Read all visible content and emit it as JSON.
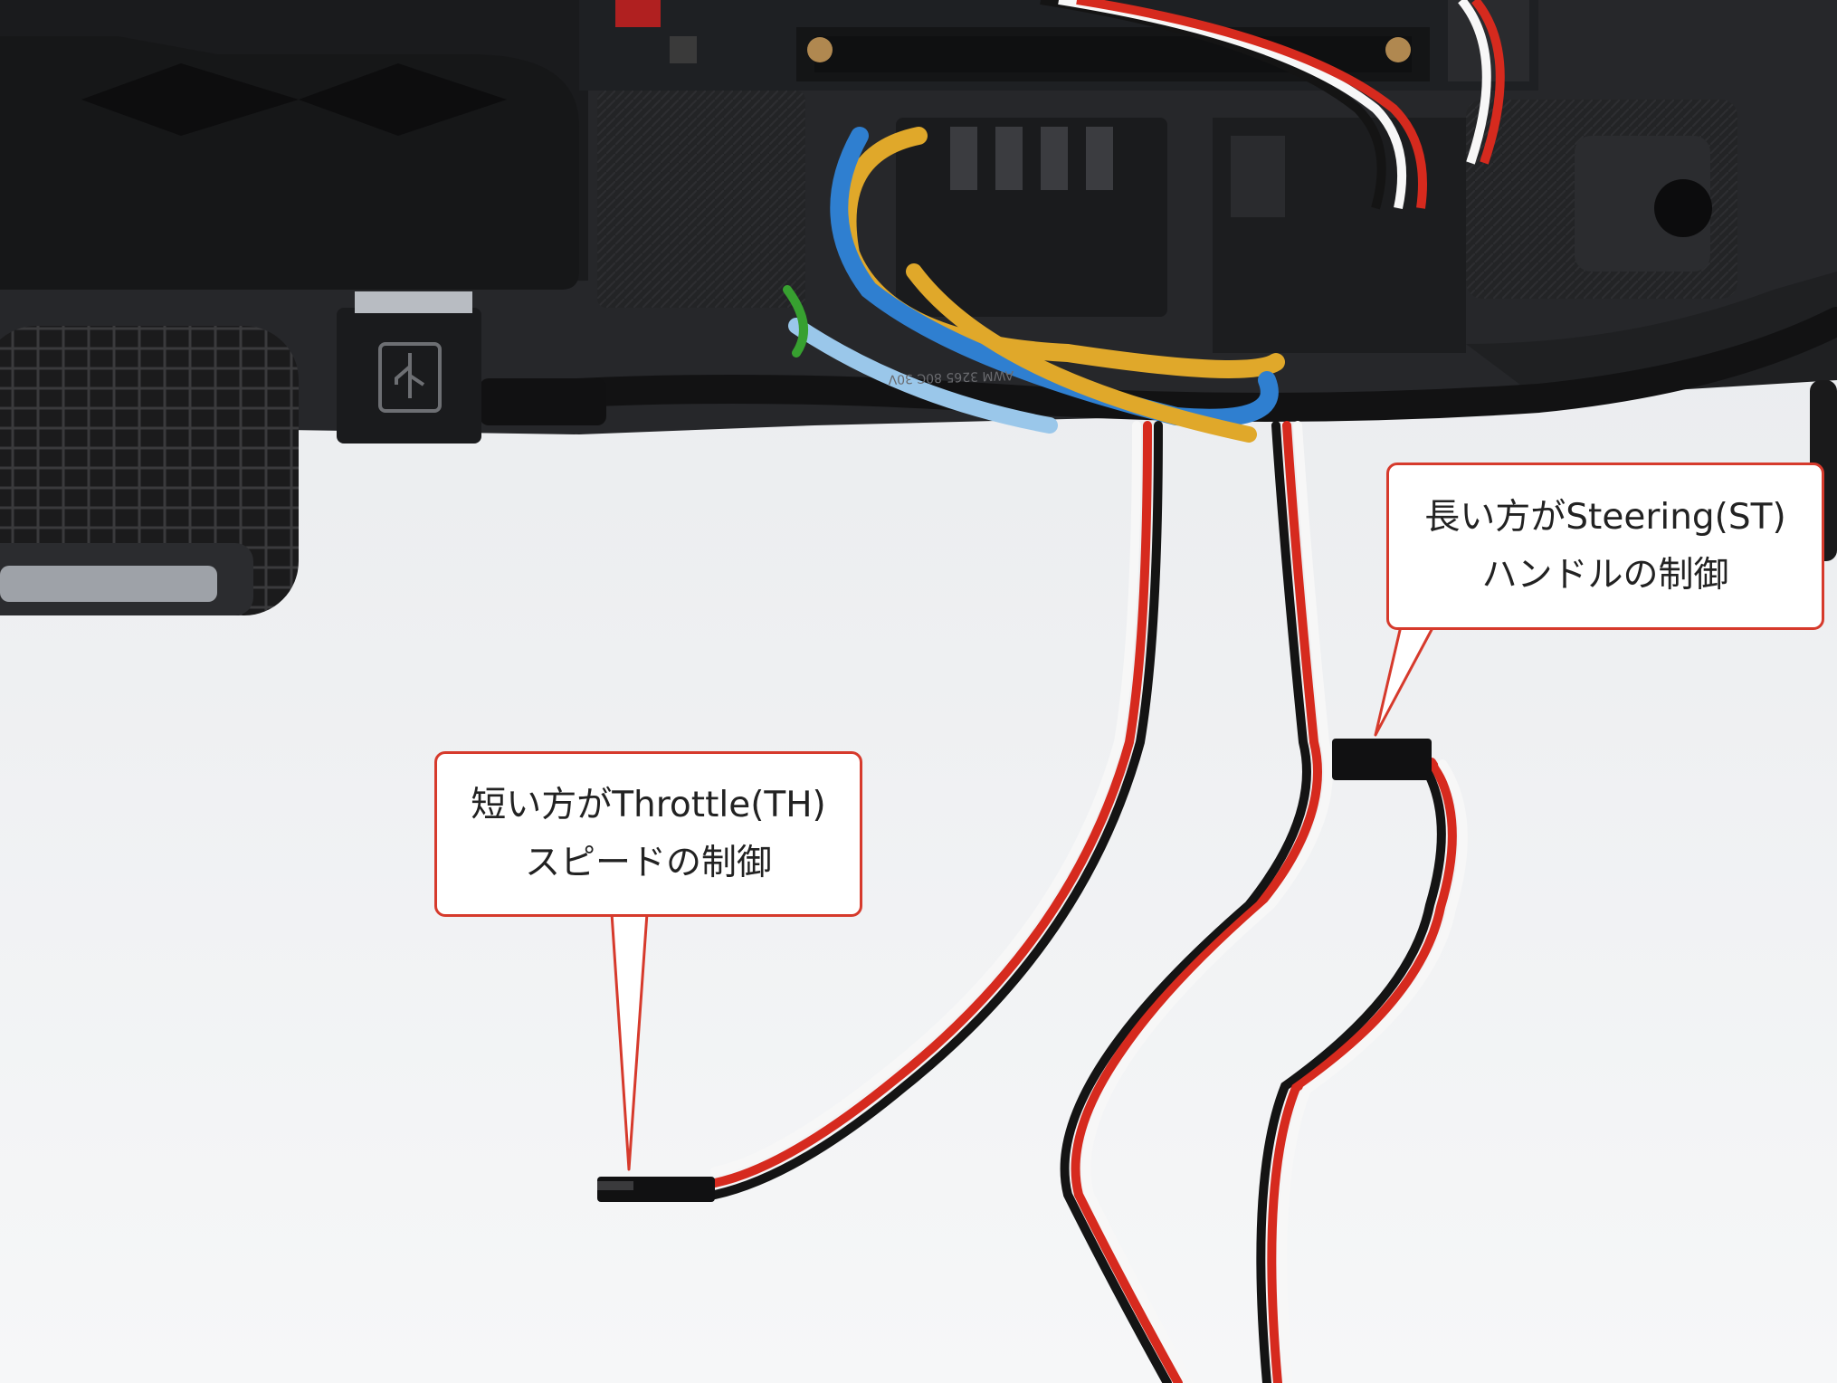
{
  "image": {
    "kind": "photo",
    "subject": "RC car chassis with servo cables",
    "label_visible_text": "AWM 3265 80C 30V"
  },
  "callouts": {
    "steering": {
      "line1": "長い方がSteering(ST)",
      "line2": "ハンドルの制御"
    },
    "throttle": {
      "line1": "短い方がThrottle(TH)",
      "line2": "スピードの制御"
    }
  },
  "colors": {
    "callout_border": "#d63a2c",
    "callout_fill": "#ffffff",
    "cable_red": "#d62a1e",
    "cable_black": "#141414",
    "cable_white": "#f7f7f7",
    "wire_blue": "#2f7fd0",
    "wire_yellow": "#e0a82a",
    "chassis": "#1e1f21"
  },
  "icons": [
    "usb-icon"
  ]
}
